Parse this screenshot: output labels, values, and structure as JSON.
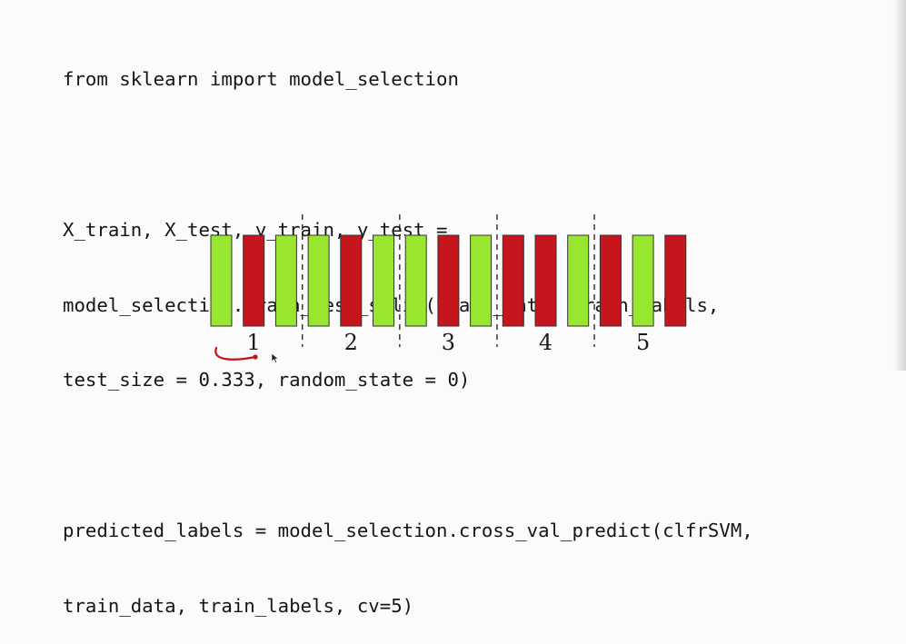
{
  "code": {
    "blocks": [
      [
        "from sklearn import model_selection"
      ],
      [
        "X_train, X_test, y_train, y_test =",
        "model_selection.train_test_split(train_data, train_labels,",
        "test_size = 0.333, random_state = 0)"
      ],
      [
        "predicted_labels = model_selection.cross_val_predict(clfrSVM,",
        "train_data, train_labels, cv=5)"
      ]
    ]
  },
  "diagram": {
    "colors": {
      "green": "#99e630",
      "red": "#c5161d",
      "outline": "#333333"
    },
    "bars": [
      "green",
      "red",
      "green",
      "green",
      "red",
      "green",
      "green",
      "red",
      "green",
      "red",
      "red",
      "green",
      "red",
      "green",
      "red"
    ],
    "folds": [
      "1",
      "2",
      "3",
      "4",
      "5"
    ]
  }
}
